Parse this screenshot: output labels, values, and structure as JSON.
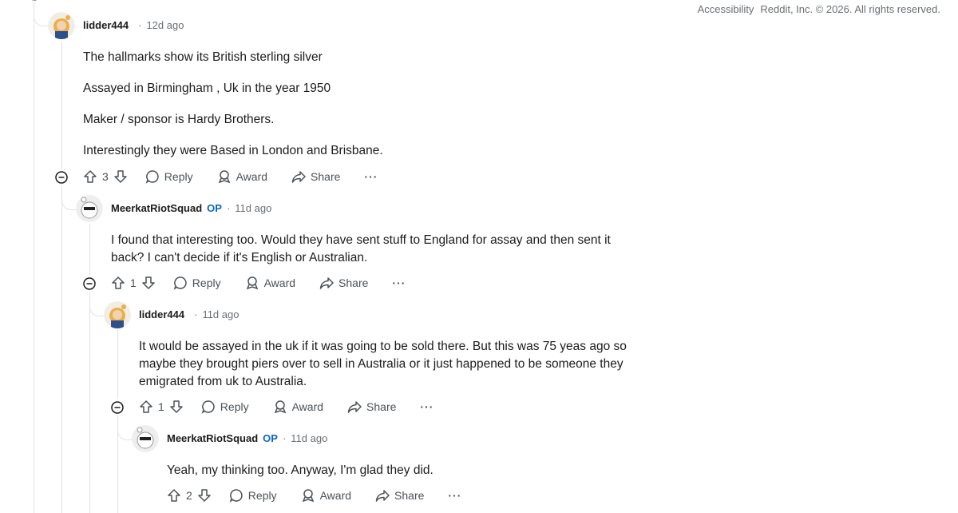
{
  "footer": {
    "accessibility": "Accessibility",
    "copyright": "Reddit, Inc. © 2026. All rights reserved."
  },
  "comments": [
    {
      "author": "lidder444",
      "op": "",
      "time": "12d ago",
      "paragraphs": [
        "The hallmarks show its British sterling silver",
        "Assayed in Birmingham , Uk in the year 1950",
        "Maker / sponsor is Hardy Brothers.",
        "Interestingly they were Based in London and Brisbane."
      ],
      "votes": "3",
      "reply": "Reply",
      "award": "Award",
      "share": "Share",
      "more": "···"
    },
    {
      "author": "MeerkatRiotSquad",
      "op": "OP",
      "time": "11d ago",
      "paragraphs": [
        "I found that interesting too. Would they have sent stuff to England for assay and then sent it back? I can't decide if it's English or Australian."
      ],
      "votes": "1",
      "reply": "Reply",
      "award": "Award",
      "share": "Share",
      "more": "···"
    },
    {
      "author": "lidder444",
      "op": "",
      "time": "11d ago",
      "paragraphs": [
        "It would be assayed in the uk if it was going to be sold there. But this was 75 yeas ago so maybe they brought piers over to sell in Australia or it just happened to be someone they emigrated from uk to Australia."
      ],
      "votes": "1",
      "reply": "Reply",
      "award": "Award",
      "share": "Share",
      "more": "···"
    },
    {
      "author": "MeerkatRiotSquad",
      "op": "OP",
      "time": "11d ago",
      "paragraphs": [
        "Yeah, my thinking too. Anyway, I'm glad they did."
      ],
      "votes": "2",
      "reply": "Reply",
      "award": "Award",
      "share": "Share",
      "more": "···"
    }
  ],
  "icons": {
    "upvote": "upvote-icon",
    "downvote": "downvote-icon",
    "reply": "comment-icon",
    "award": "award-icon",
    "share": "share-icon",
    "collapse": "collapse-icon"
  },
  "colors": {
    "op": "#0a66c2",
    "meta": "#6a6f73",
    "thread": "#e0e3e6"
  }
}
